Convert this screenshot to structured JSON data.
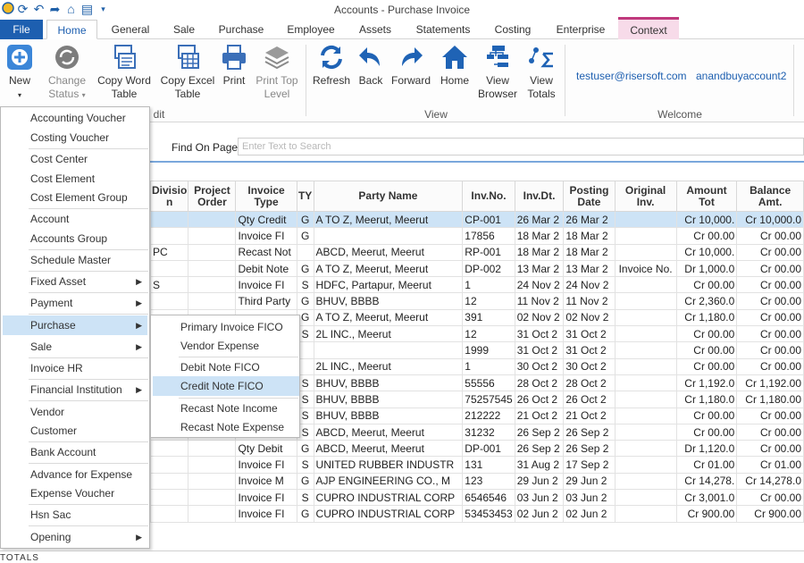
{
  "window": {
    "title": "Accounts - Purchase Invoice"
  },
  "tabs": [
    "File",
    "Home",
    "General",
    "Sale",
    "Purchase",
    "Employee",
    "Assets",
    "Statements",
    "Costing",
    "Enterprise",
    "Context"
  ],
  "ribbon": {
    "new": "New",
    "change_status": [
      "Change",
      "Status"
    ],
    "copy_word": [
      "Copy Word",
      "Table"
    ],
    "copy_excel": [
      "Copy Excel",
      "Table"
    ],
    "print": "Print",
    "print_top": [
      "Print Top",
      "Level"
    ],
    "refresh": "Refresh",
    "back": "Back",
    "forward": "Forward",
    "home": "Home",
    "view_browser": [
      "View",
      "Browser"
    ],
    "view_totals": [
      "View",
      "Totals"
    ],
    "group_edit_partial": "dit",
    "group_view": "View",
    "group_welcome": "Welcome",
    "user_email": "testuser@risersoft.com",
    "account": "anandbuyaccount2"
  },
  "find": {
    "label": "Find On Page",
    "placeholder": "Enter Text to Search"
  },
  "table": {
    "headers": [
      "Divisio\nn",
      "Project\nOrder",
      "Invoice\nType",
      "TY",
      "Party Name",
      "Inv.No.",
      "Inv.Dt.",
      "Posting\nDate",
      "Original\nInv.",
      "Amount\nTot",
      "Balance\nAmt."
    ],
    "rows": [
      [
        "",
        "",
        "Qty Credit",
        "G",
        "A TO Z, Meerut, Meerut",
        "CP-001",
        "26 Mar 2",
        "26 Mar 2",
        "",
        "Cr 10,000.",
        "Cr 10,000.0"
      ],
      [
        "",
        "",
        "Invoice FI",
        "G",
        "",
        "17856",
        "18 Mar 2",
        "18 Mar 2",
        "",
        "Cr 00.00",
        "Cr 00.00"
      ],
      [
        "PC",
        "",
        "Recast Not",
        "",
        "ABCD, Meerut, Meerut",
        "RP-001",
        "18 Mar 2",
        "18 Mar 2",
        "",
        "Cr 10,000.",
        "Cr 00.00"
      ],
      [
        "",
        "",
        "Debit Note",
        "G",
        "A TO Z, Meerut, Meerut",
        "DP-002",
        "13 Mar 2",
        "13 Mar 2",
        "Invoice No.",
        "Dr 1,000.0",
        "Cr 00.00"
      ],
      [
        "S",
        "",
        "Invoice FI",
        "S",
        "HDFC, Partapur, Meerut",
        "1",
        "24 Nov 2",
        "24 Nov 2",
        "",
        "Cr 00.00",
        "Cr 00.00"
      ],
      [
        "",
        "",
        "Third Party",
        "G",
        "BHUV, BBBB",
        "12",
        "11 Nov 2",
        "11 Nov 2",
        "",
        "Cr 2,360.0",
        "Cr 00.00"
      ],
      [
        "",
        "",
        "",
        "G",
        "A TO Z, Meerut, Meerut",
        "391",
        "02 Nov 2",
        "02 Nov 2",
        "",
        "Cr 1,180.0",
        "Cr 00.00"
      ],
      [
        "",
        "",
        "",
        "S",
        "2L INC., Meerut",
        "12",
        "31 Oct 2",
        "31 Oct 2",
        "",
        "Cr 00.00",
        "Cr 00.00"
      ],
      [
        "",
        "",
        "",
        "",
        "",
        "1999",
        "31 Oct 2",
        "31 Oct 2",
        "",
        "Cr 00.00",
        "Cr 00.00"
      ],
      [
        "",
        "",
        "",
        "",
        "2L INC., Meerut",
        "1",
        "30 Oct 2",
        "30 Oct 2",
        "",
        "Cr 00.00",
        "Cr 00.00"
      ],
      [
        "",
        "",
        "",
        "S",
        "BHUV, BBBB",
        "55556",
        "28 Oct 2",
        "28 Oct 2",
        "",
        "Cr 1,192.0",
        "Cr 1,192.00"
      ],
      [
        "",
        "",
        "",
        "S",
        "BHUV, BBBB",
        "75257545",
        "26 Oct 2",
        "26 Oct 2",
        "",
        "Cr 1,180.0",
        "Cr 1,180.00"
      ],
      [
        "",
        "",
        "",
        "S",
        "BHUV, BBBB",
        "212222",
        "21 Oct 2",
        "21 Oct 2",
        "",
        "Cr 00.00",
        "Cr 00.00"
      ],
      [
        "",
        "",
        "",
        "S",
        "ABCD, Meerut, Meerut",
        "31232",
        "26 Sep 2",
        "26 Sep 2",
        "",
        "Cr 00.00",
        "Cr 00.00"
      ],
      [
        "",
        "",
        "Qty Debit",
        "G",
        "ABCD, Meerut, Meerut",
        "DP-001",
        "26 Sep 2",
        "26 Sep 2",
        "",
        "Dr 1,120.0",
        "Cr 00.00"
      ],
      [
        "",
        "",
        "Invoice FI",
        "S",
        "UNITED  RUBBER INDUSTR",
        "131",
        "31 Aug 2",
        "17 Sep 2",
        "",
        "Cr 01.00",
        "Cr 01.00"
      ],
      [
        "",
        "",
        "Invoice M",
        "G",
        "AJP  ENGINEERING  CO., M",
        "123",
        "29 Jun 2",
        "29 Jun 2",
        "",
        "Cr 14,278.",
        "Cr 14,278.0"
      ],
      [
        "",
        "",
        "Invoice FI",
        "S",
        "CUPRO  INDUSTRIAL CORP",
        "6546546",
        "03 Jun 2",
        "03 Jun 2",
        "",
        "Cr 3,001.0",
        "Cr 00.00"
      ],
      [
        "",
        "",
        "Invoice FI",
        "G",
        "CUPRO  INDUSTRIAL CORP",
        "53453453",
        "02 Jun 2",
        "02 Jun 2",
        "",
        "Cr 900.00",
        "Cr 900.00"
      ]
    ]
  },
  "menu": {
    "items": [
      "Accounting Voucher",
      "Costing Voucher",
      "Cost Center",
      "Cost Element",
      "Cost Element Group",
      "Account",
      "Accounts Group",
      "Schedule Master",
      "Fixed Asset",
      "Payment",
      "Purchase",
      "Sale",
      "Invoice HR",
      "Financial Institution",
      "Vendor",
      "Customer",
      "Bank Account",
      "Advance for Expense",
      "Expense Voucher",
      "Hsn Sac",
      "Opening"
    ]
  },
  "submenu": {
    "items": [
      "Primary Invoice FICO",
      "Vendor Expense",
      "Debit Note FICO",
      "Credit Note FICO",
      "Recast Note Income",
      "Recast Note Expense"
    ]
  },
  "footer": {
    "totals": "TOTALS"
  }
}
